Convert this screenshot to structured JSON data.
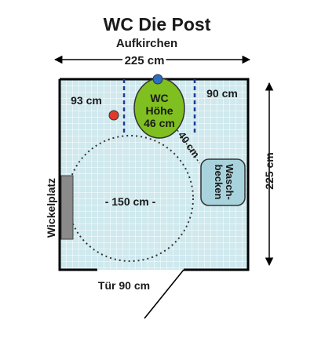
{
  "title": "WC Die Post",
  "subtitle": "Aufkirchen",
  "dimensions": {
    "width_top": "225 cm",
    "height_right": "225 cm",
    "left_gap": "93 cm",
    "right_gap": "90 cm",
    "turning_circle": "- 150 cm -",
    "wc_to_sink": "40 cm",
    "door": "Tür 90 cm"
  },
  "wc": {
    "line1": "WC",
    "line2": "Höhe",
    "line3": "46 cm"
  },
  "sink": {
    "line1": "Wasch-",
    "line2": "becken"
  },
  "changing_table": "Wickelplatz",
  "colors": {
    "floor": "#cfe9ee",
    "tile_line": "#ffffff",
    "wall": "#000000",
    "wc": "#7fbf1f",
    "sink": "#a9d3dc",
    "changing_table": "#8a8a8a",
    "grab_bar": "#1f3a93",
    "flush_button": "#2a6fc4",
    "emergency_button": "#e03a2a"
  }
}
